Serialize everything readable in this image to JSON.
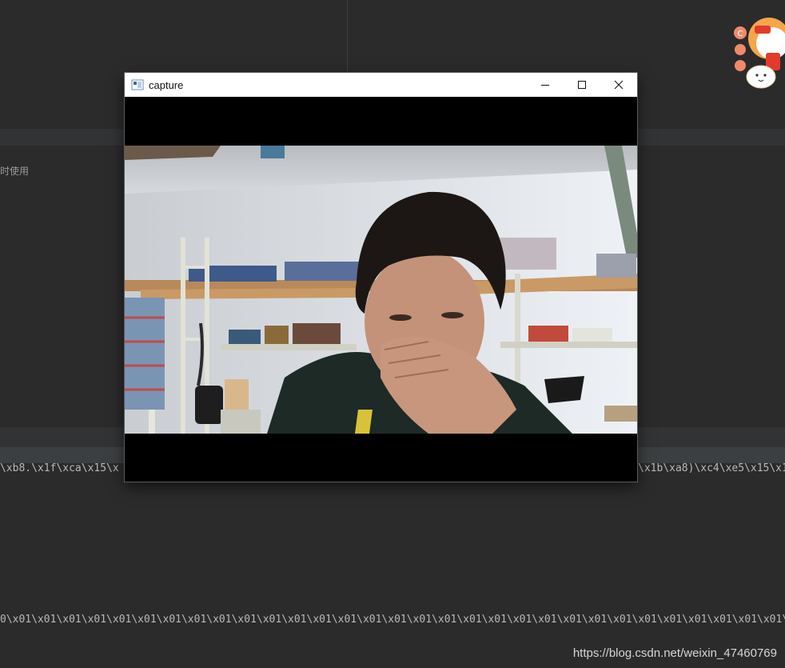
{
  "background": {
    "hint_text": "时使用",
    "console_line_1": "\\xb8.\\x1f\\xca\\x15\\x",
    "console_line_1_right": "\\x1b\\xa8)\\xc4\\xe5\\x15\\x1",
    "console_line_2": "0\\x01\\x01\\x01\\x01\\x01\\x01\\x01\\x01\\x01\\x01\\x01\\x01\\x01\\x01\\x01\\x01\\x01\\x01\\x01\\x01\\x01\\x01\\x01\\x01\\x01\\x01\\x01\\x01\\x01\\x01\\x01\\x01\\x0",
    "watermark": "https://blog.csdn.net/weixin_47460769"
  },
  "mascot": {
    "badge_1": "C",
    "icon": "mascot-sticker-icon"
  },
  "window": {
    "title": "capture",
    "app_icon": "window-app-icon",
    "controls": {
      "minimize_icon": "minimize-icon",
      "maximize_icon": "maximize-icon",
      "close_icon": "close-icon"
    }
  },
  "colors": {
    "ide_background": "#2b2b2b",
    "titlebar": "#ffffff",
    "video_letterbox": "#000000"
  }
}
